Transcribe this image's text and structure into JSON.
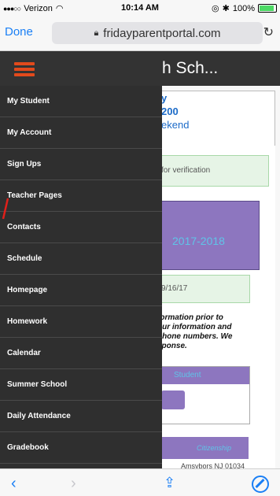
{
  "status_bar": {
    "carrier": "Verizon",
    "time": "10:14 AM",
    "battery": "100%",
    "battery_level": 1.0
  },
  "browser": {
    "done_label": "Done",
    "url": "fridayparentportal.com",
    "reload_icon": "reload-icon"
  },
  "page": {
    "title": "Senior High Sch...",
    "info_lines": [
      "y",
      "200",
      "ekend"
    ],
    "verification_text": "for verification",
    "year_text": "2017-2018",
    "date_text": "9/16/17",
    "notice_lines": [
      "formation prior to",
      "our information and",
      "phone numbers.  We",
      "sponse."
    ],
    "link_text": "Student",
    "citizenship_text": "Citizenship",
    "address_text": "Amsybors NJ 01034"
  },
  "drawer": {
    "menu_icon": "hamburger-icon",
    "items": [
      "My Student",
      "My Account",
      "Sign Ups",
      "Teacher Pages",
      "Contacts",
      "Schedule",
      "Homepage",
      "Homework",
      "Calendar",
      "Summer School",
      "Daily Attendance",
      "Gradebook"
    ]
  },
  "toolbar": {
    "back": "‹",
    "forward": "›",
    "share_icon": "share-icon",
    "bookmarks_icon": "compass-icon"
  },
  "colors": {
    "accent": "#1a7ff5",
    "drawer_bg": "#2f2f2f",
    "hamburger": "#e24a1c",
    "purple": "#8d76bf",
    "green_box": "#e6f4e6"
  }
}
